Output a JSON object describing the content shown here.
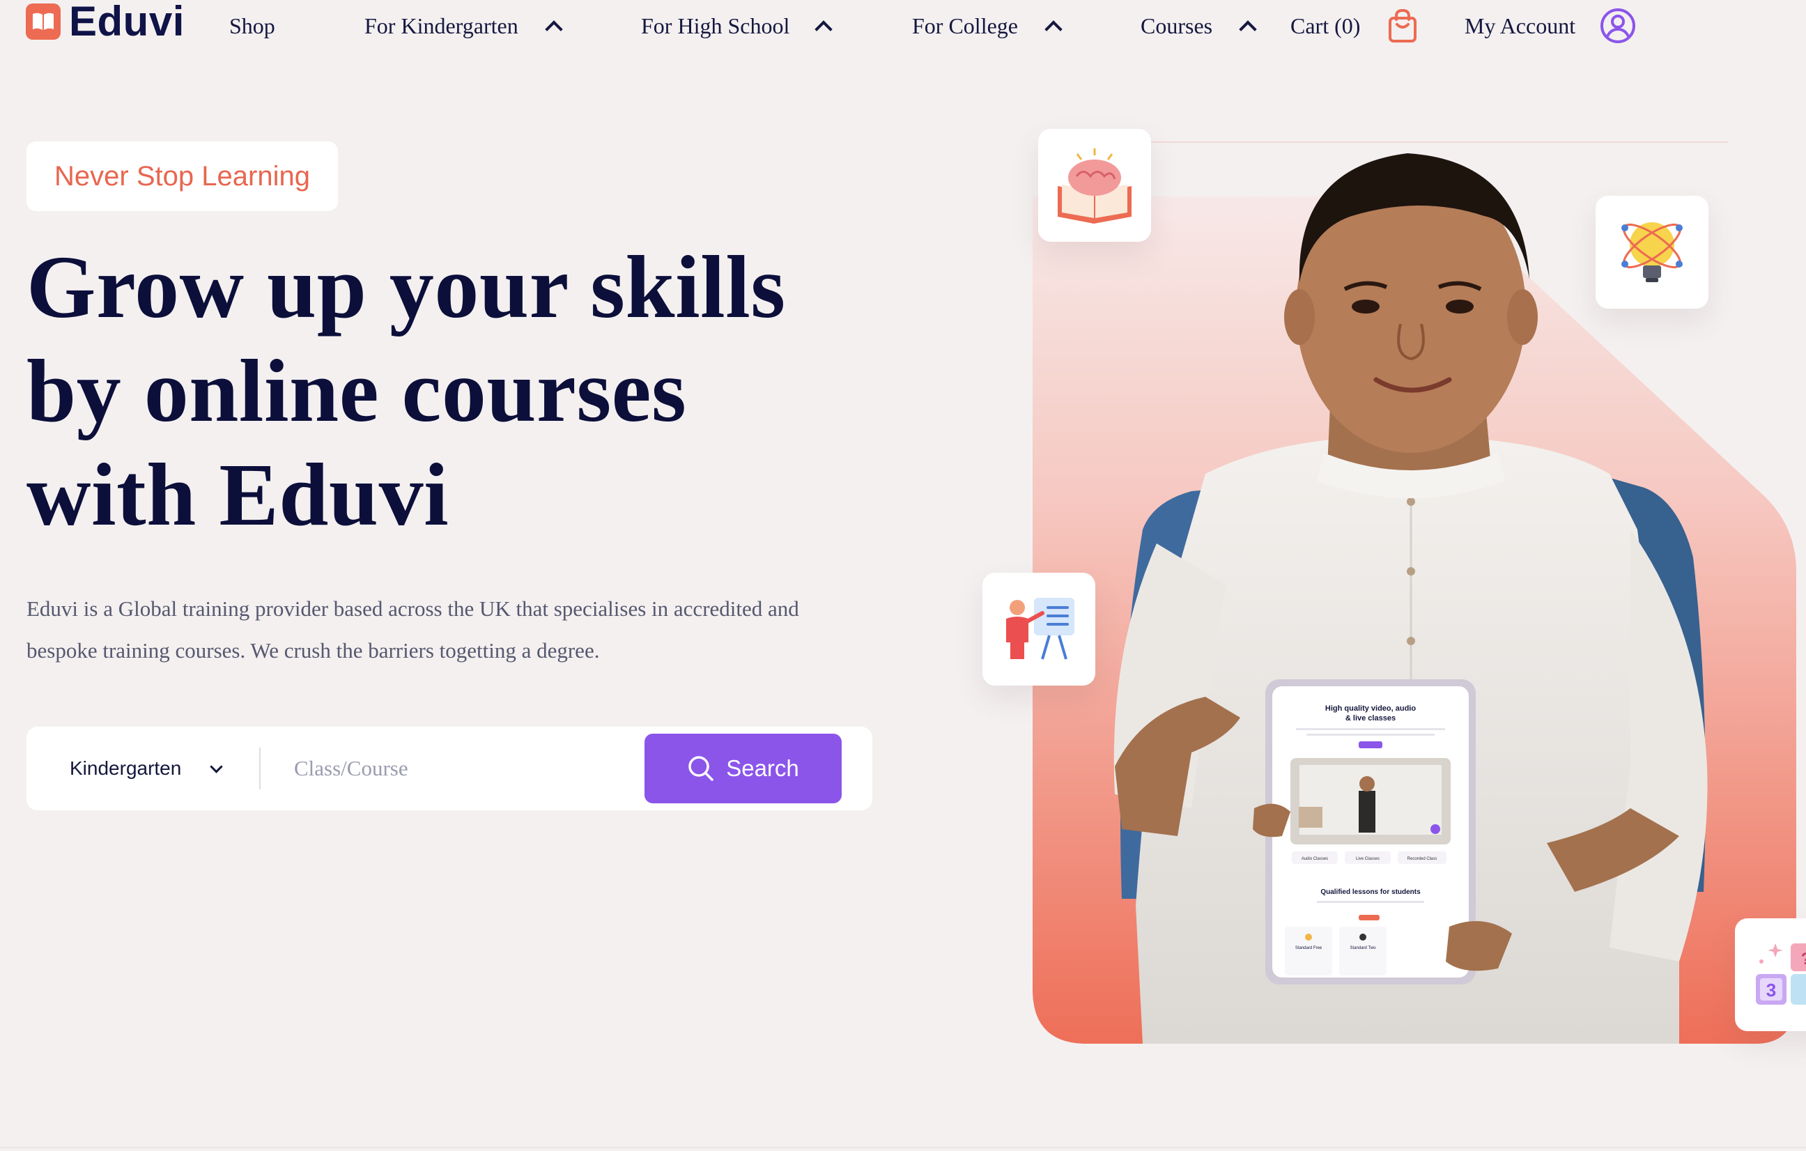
{
  "brand": {
    "name": "Eduvi",
    "accent": "#ec6b52",
    "primary_purple": "#8b55ea",
    "navy": "#0c0f3a",
    "background": "#f4f0f0"
  },
  "nav": {
    "items": [
      {
        "label": "Shop",
        "icon": null
      },
      {
        "label": "For Kindergarten",
        "icon": "chevron-up-icon"
      },
      {
        "label": "For High School",
        "icon": "chevron-up-icon"
      },
      {
        "label": "For College",
        "icon": "chevron-up-icon"
      },
      {
        "label": "Courses",
        "icon": "chevron-up-icon"
      }
    ],
    "cart_label": "Cart (0)",
    "cart_icon": "shopping-bag-icon",
    "account_label": "My Account",
    "account_icon": "user-circle-icon"
  },
  "hero": {
    "tag": "Never Stop Learning",
    "headline_lines": [
      "Grow up your skills",
      "by online courses",
      "with Eduvi"
    ],
    "description_lines": [
      "Eduvi is a Global training provider based across the UK that specialises in accredited and",
      "bespoke training courses. We crush the barriers togetting a degree."
    ]
  },
  "search": {
    "select_value": "Kindergarten",
    "placeholder": "Class/Course",
    "value": "",
    "button_label": "Search",
    "button_icon": "search-icon"
  },
  "tablet": {
    "heading_1": "High quality video, audio",
    "heading_2": "& live classes",
    "chips": [
      "Audio Classes",
      "Live Classes",
      "Recorded Class"
    ],
    "section_title": "Qualified lessons for students",
    "plans": [
      "Standard Free",
      "Standard Two"
    ]
  },
  "floating_icons": [
    "brain-book-icon",
    "atom-bulb-icon",
    "teacher-board-icon",
    "number-blocks-icon"
  ]
}
